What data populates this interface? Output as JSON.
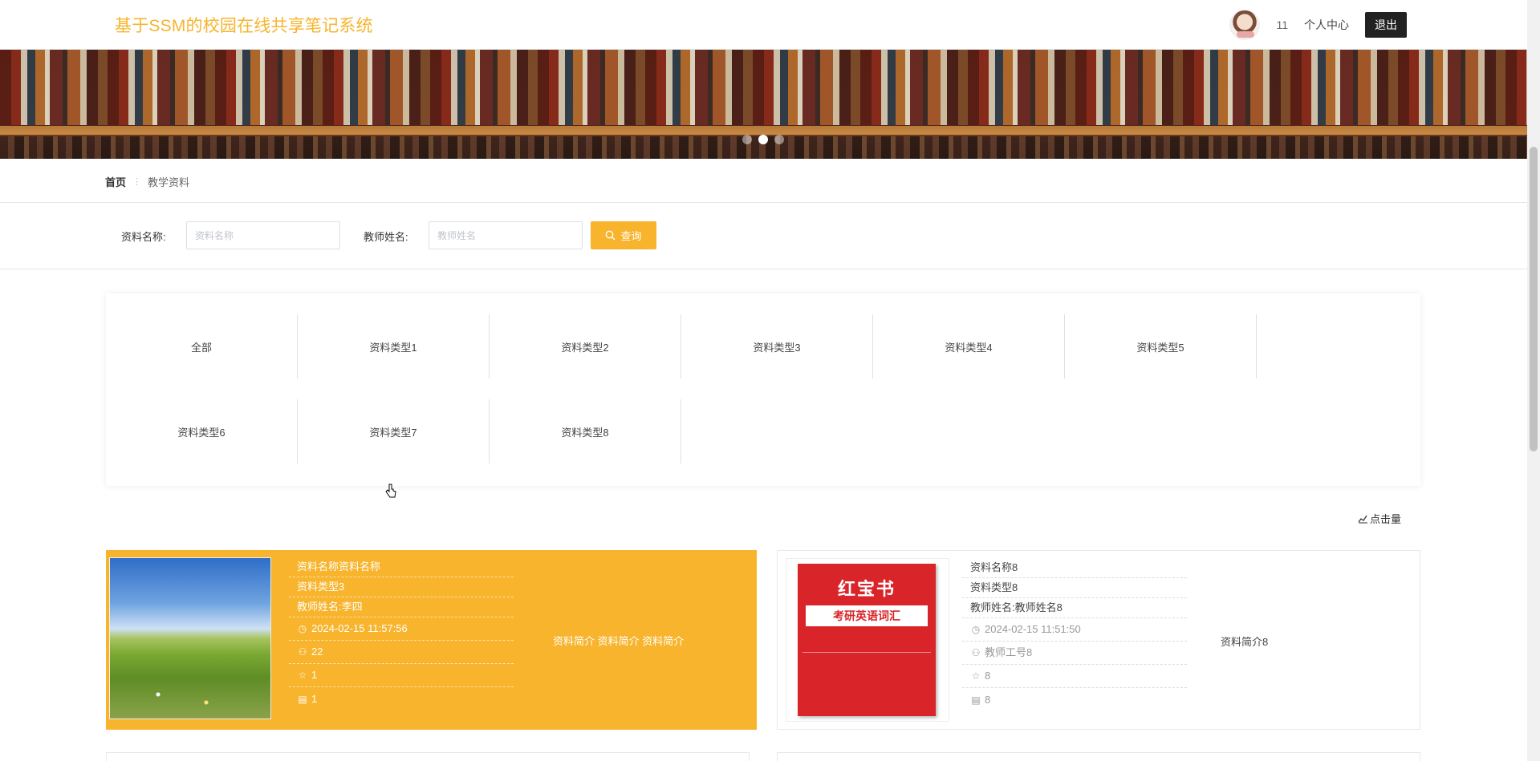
{
  "header": {
    "site_title": "基于SSM的校园在线共享笔记系统",
    "user_name": "11",
    "profile_link": "个人中心",
    "logout_label": "退出"
  },
  "banner": {
    "slide_count": 3,
    "active_slide": 2
  },
  "breadcrumb": {
    "home": "首页",
    "separator": "⋮",
    "current": "教学资料"
  },
  "search": {
    "name_label": "资料名称:",
    "name_placeholder": "资料名称",
    "teacher_label": "教师姓名:",
    "teacher_placeholder": "教师姓名",
    "query_button": "查询"
  },
  "categories": [
    "全部",
    "资料类型1",
    "资料类型2",
    "资料类型3",
    "资料类型4",
    "资料类型5",
    "资料类型6",
    "资料类型7",
    "资料类型8"
  ],
  "sort": {
    "click_rank_label": "点击量"
  },
  "cards": [
    {
      "name": "资料名称资料名称",
      "type": "资料类型3",
      "teacher": "教师姓名:李四",
      "time": "2024-02-15 11:57:56",
      "user": "22",
      "favorites": "1",
      "comments": "1",
      "intro": "资料简介 资料简介 资料简介"
    },
    {
      "name": "资料名称8",
      "type": "资料类型8",
      "teacher": "教师姓名:教师姓名8",
      "time": "2024-02-15 11:51:50",
      "user": "教师工号8",
      "favorites": "8",
      "comments": "8",
      "intro": "资料简介8",
      "cover_title": "红宝书",
      "cover_subtitle": "考研英语词汇"
    }
  ],
  "colors": {
    "accent": "#f7b42c",
    "dark_button": "#222222"
  }
}
